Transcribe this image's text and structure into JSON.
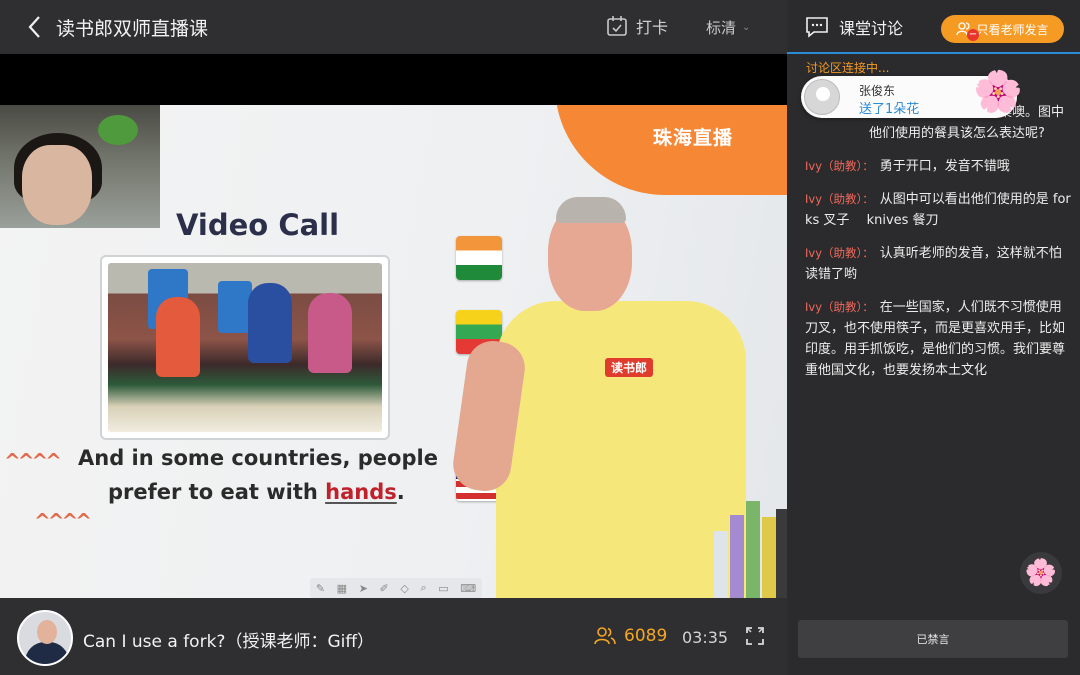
{
  "header": {
    "title": "读书郎双师直播课",
    "checkin_label": "打卡",
    "quality_label": "标清"
  },
  "video": {
    "channel_logo": "珠海直播",
    "slide_title": "Video Call",
    "caption_line1": "And in some countries, people",
    "caption_line2_prefix": "prefer to eat with ",
    "caption_answer": "hands",
    "caption_suffix": ".",
    "shirt_logo": "读书郎"
  },
  "footer": {
    "course_title": "Can I use a fork?（授课老师：Giff）",
    "online_count": "6089",
    "elapsed_time": "03:35"
  },
  "chat": {
    "title": "课堂讨论",
    "teacher_only_label": "只看老师发言",
    "status": "讨论区连接中...",
    "gift_toast": {
      "name": "张俊东",
      "text": "送了1朵花"
    },
    "messages": [
      {
        "sender": "",
        "text": "…可以从图片中找到答案噢。图中他们使用的餐具该怎么表达呢?"
      },
      {
        "sender": "Ivy（助教）：",
        "text": "勇于开口，发音不错哦"
      },
      {
        "sender": "Ivy（助教）：",
        "text": "从图中可以看出他们使用的是 forks 叉子　 knives 餐刀"
      },
      {
        "sender": "Ivy（助教）：",
        "text": "认真听老师的发音，这样就不怕读错了哟"
      },
      {
        "sender": "Ivy（助教）：",
        "text": "在一些国家，人们既不习惯使用刀叉，也不使用筷子，而是更喜欢用手，比如印度。用手抓饭吃，是他们的习惯。我们要尊重他国文化，也要发扬本土文化"
      }
    ],
    "muted_label": "已禁言"
  },
  "colors": {
    "accent_orange": "#f59a23",
    "accent_blue": "#2a8ad4",
    "sender_red": "#f1685b"
  }
}
